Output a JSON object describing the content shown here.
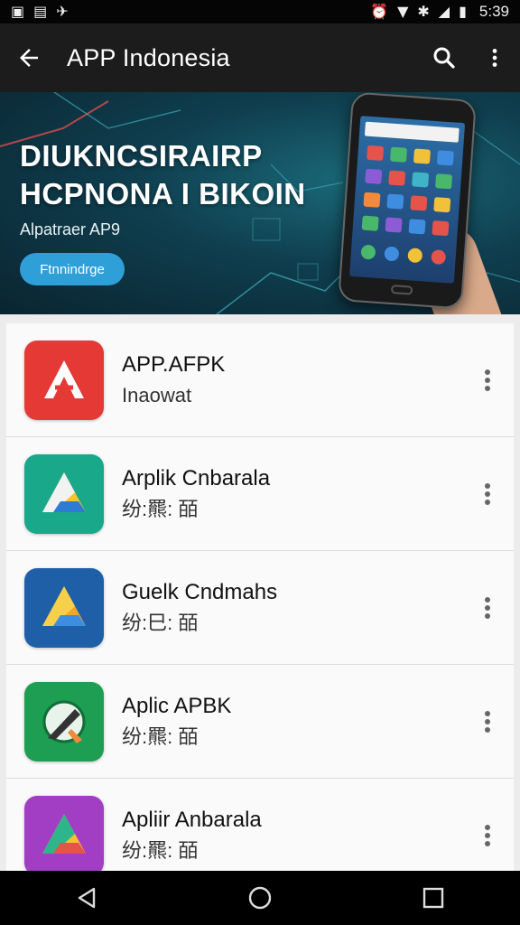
{
  "status_bar": {
    "time": "5:39",
    "left_icons": [
      "gallery-icon",
      "image-icon",
      "airplane-icon"
    ],
    "right_icons": [
      "alarm-icon",
      "wifi-icon",
      "bluetooth-icon",
      "signal-icon",
      "battery-icon"
    ]
  },
  "app_bar": {
    "title": "APP Indonesia",
    "back_icon": "arrow-back-icon",
    "search_icon": "search-icon",
    "more_icon": "more-vert-icon"
  },
  "banner": {
    "headline_line1": "DIUKNCSIRAIRP",
    "headline_line2": "HCPNONA I BIKOIN",
    "subtitle": "Alpatraer AP9",
    "button_label": "Ftnnindrge"
  },
  "apps": [
    {
      "name": "APP.AFPK",
      "subtitle": "Inaowat",
      "icon": "red-app-icon",
      "icon_color": "#e53935"
    },
    {
      "name": "Arplik Cnbarala",
      "subtitle": "纷:羆: 皕",
      "icon": "teal-triangle-app-icon",
      "icon_color": "#1aa88a"
    },
    {
      "name": "Guelk Cndmahs",
      "subtitle": "纷:巳: 皕",
      "icon": "blue-triangle-app-icon",
      "icon_color": "#1e5fa8"
    },
    {
      "name": "Aplic APBK",
      "subtitle": "纷:羆: 皕",
      "icon": "green-compass-app-icon",
      "icon_color": "#1e9e52"
    },
    {
      "name": "Apliir Anbarala",
      "subtitle": "纷:羆: 皕",
      "icon": "purple-triangle-app-icon",
      "icon_color": "#a23ec4"
    }
  ],
  "nav_bar": {
    "back": "nav-back-icon",
    "home": "nav-home-icon",
    "recents": "nav-recents-icon"
  }
}
